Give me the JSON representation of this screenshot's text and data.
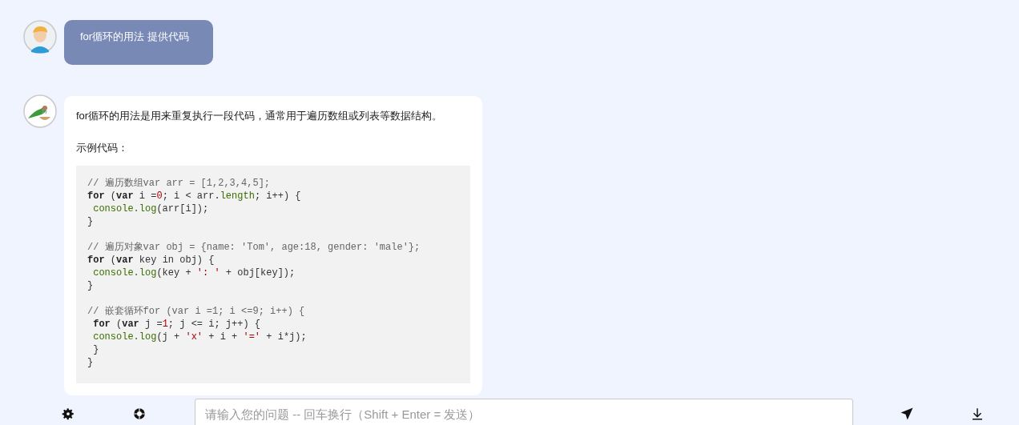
{
  "messages": [
    {
      "kind": "user",
      "text": "for循环的用法 提供代码"
    },
    {
      "kind": "assistant",
      "paragraphs": [
        "for循环的用法是用来重复执行一段代码，通常用于遍历数组或列表等数据结构。",
        "示例代码："
      ],
      "code_blocks": [
        [
          [
            {
              "kind": "comment",
              "text": "// 遍历数组var arr = [1,2,3,4,5];"
            }
          ],
          [
            {
              "kind": "keyword",
              "text": "for"
            },
            {
              "kind": "plain",
              "text": " ("
            },
            {
              "kind": "keyword",
              "text": "var"
            },
            {
              "kind": "plain",
              "text": " i ="
            },
            {
              "kind": "number",
              "text": "0"
            },
            {
              "kind": "plain",
              "text": "; i < arr."
            },
            {
              "kind": "function",
              "text": "length"
            },
            {
              "kind": "plain",
              "text": "; i++) {"
            }
          ],
          [
            {
              "kind": "function",
              "text": " console.log"
            },
            {
              "kind": "plain",
              "text": "(arr[i]);"
            }
          ],
          [
            {
              "kind": "plain",
              "text": "}"
            }
          ]
        ],
        [
          [
            {
              "kind": "comment",
              "text": "// 遍历对象var obj = {name: 'Tom', age:18, gender: 'male'};"
            }
          ],
          [
            {
              "kind": "keyword",
              "text": "for"
            },
            {
              "kind": "plain",
              "text": " ("
            },
            {
              "kind": "keyword",
              "text": "var"
            },
            {
              "kind": "plain",
              "text": " key in obj) {"
            }
          ],
          [
            {
              "kind": "function",
              "text": " console.log"
            },
            {
              "kind": "plain",
              "text": "(key + "
            },
            {
              "kind": "string",
              "text": "': '"
            },
            {
              "kind": "plain",
              "text": " + obj[key]);"
            }
          ],
          [
            {
              "kind": "plain",
              "text": "}"
            }
          ]
        ],
        [
          [
            {
              "kind": "comment",
              "text": "// 嵌套循环for (var i =1; i <=9; i++) {"
            }
          ],
          [
            {
              "kind": "keyword",
              "text": " for"
            },
            {
              "kind": "plain",
              "text": " ("
            },
            {
              "kind": "keyword",
              "text": "var"
            },
            {
              "kind": "plain",
              "text": " j ="
            },
            {
              "kind": "number",
              "text": "1"
            },
            {
              "kind": "plain",
              "text": "; j <= i; j++) {"
            }
          ],
          [
            {
              "kind": "function",
              "text": " console.log"
            },
            {
              "kind": "plain",
              "text": "(j + "
            },
            {
              "kind": "string",
              "text": "'x'"
            },
            {
              "kind": "plain",
              "text": " + i + "
            },
            {
              "kind": "string",
              "text": "'='"
            },
            {
              "kind": "plain",
              "text": " + i*j);"
            }
          ],
          [
            {
              "kind": "plain",
              "text": " }"
            }
          ],
          [
            {
              "kind": "plain",
              "text": "}"
            }
          ]
        ]
      ]
    }
  ],
  "composer": {
    "placeholder": "请输入您的问题 -- 回车换行（Shift + Enter = 发送）"
  }
}
